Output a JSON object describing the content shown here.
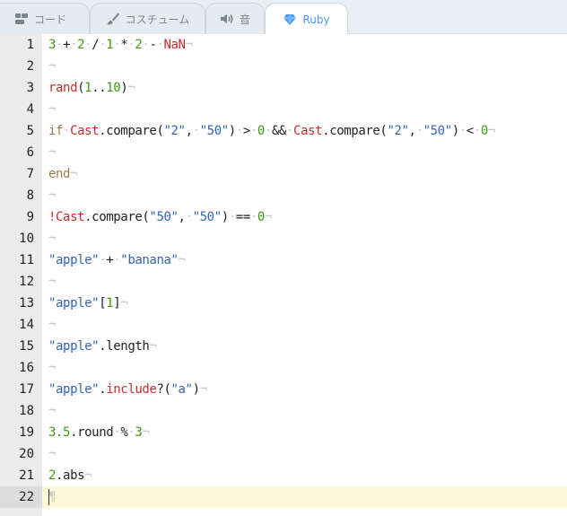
{
  "tabs": [
    {
      "label": "コード",
      "icon": "code-icon",
      "active": false
    },
    {
      "label": "コスチューム",
      "icon": "brush-icon",
      "active": false
    },
    {
      "label": "音",
      "icon": "speaker-icon",
      "active": false
    },
    {
      "label": "Ruby",
      "icon": "ruby-gem-icon",
      "active": true
    }
  ],
  "editor": {
    "active_line": 22,
    "lines": [
      {
        "n": "1"
      },
      {
        "n": "2"
      },
      {
        "n": "3"
      },
      {
        "n": "4"
      },
      {
        "n": "5"
      },
      {
        "n": "6"
      },
      {
        "n": "7"
      },
      {
        "n": "8"
      },
      {
        "n": "9"
      },
      {
        "n": "10"
      },
      {
        "n": "11"
      },
      {
        "n": "12"
      },
      {
        "n": "13"
      },
      {
        "n": "14"
      },
      {
        "n": "15"
      },
      {
        "n": "16"
      },
      {
        "n": "17"
      },
      {
        "n": "18"
      },
      {
        "n": "19"
      },
      {
        "n": "20"
      },
      {
        "n": "21"
      },
      {
        "n": "22"
      }
    ],
    "tokens": {
      "l1": [
        "3",
        "·",
        "+",
        "·",
        "2",
        "·",
        "/",
        "·",
        "1",
        "·",
        "*",
        "·",
        "2",
        "·",
        "-",
        "·",
        "NaN",
        "¬"
      ],
      "l2": [
        "¬"
      ],
      "l3": [
        "rand",
        "(",
        "1",
        "..",
        "10",
        ")",
        "¬"
      ],
      "l4": [
        "¬"
      ],
      "l5": [
        "if",
        "·",
        "Cast",
        ".compare(",
        "\"2\"",
        ",",
        "·",
        "\"50\"",
        ")",
        "·",
        ">",
        "·",
        "0",
        "·",
        "&&",
        "·",
        "Cast",
        ".compare(",
        "\"2\"",
        ",",
        "·",
        "\"50\"",
        ")",
        "·",
        "<",
        "·",
        "0",
        "¬"
      ],
      "l6": [
        "¬"
      ],
      "l7": [
        "end",
        "¬"
      ],
      "l8": [
        "¬"
      ],
      "l9": [
        "!",
        "Cast",
        ".compare(",
        "\"50\"",
        ",",
        "·",
        "\"50\"",
        ")",
        "·",
        "==",
        "·",
        "0",
        "¬"
      ],
      "l10": [
        "¬"
      ],
      "l11": [
        "\"apple\"",
        "·",
        "+",
        "·",
        "\"banana\"",
        "¬"
      ],
      "l12": [
        "¬"
      ],
      "l13": [
        "\"apple\"",
        "[",
        "1",
        "]",
        "¬"
      ],
      "l14": [
        "¬"
      ],
      "l15": [
        "\"apple\"",
        ".length",
        "¬"
      ],
      "l16": [
        "¬"
      ],
      "l17": [
        "\"apple\"",
        ".",
        "include",
        "?(",
        "\"a\"",
        ")",
        "¬"
      ],
      "l18": [
        "¬"
      ],
      "l19": [
        "3.5",
        ".round",
        "·",
        "%",
        "·",
        "3",
        "¬"
      ],
      "l20": [
        "¬"
      ],
      "l21": [
        "2",
        ".abs",
        "¬"
      ],
      "l22": [
        "¶"
      ]
    }
  },
  "colors": {
    "number": "#3c9a13",
    "keyword": "#9b7d47",
    "constant": "#c52e2e",
    "string": "#3565b2",
    "invisible": "#c8c8c8",
    "active_line": "#fbf8d5",
    "tab_active": "#4c97ff"
  }
}
